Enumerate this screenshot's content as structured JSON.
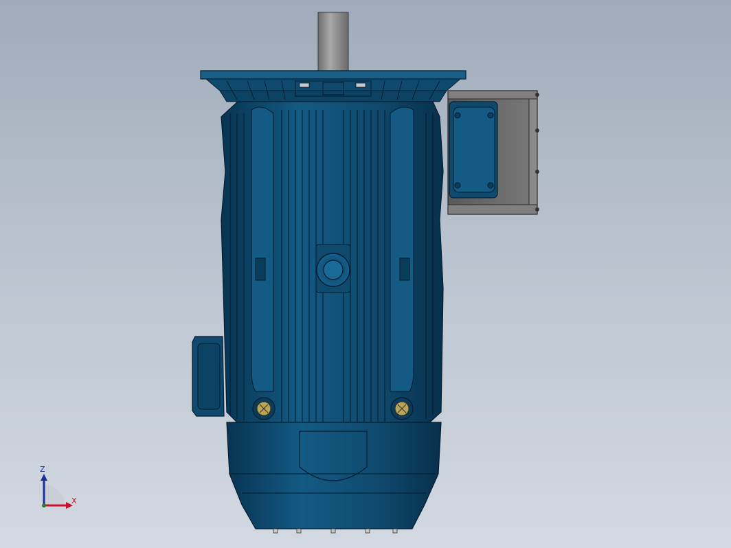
{
  "viewport": {
    "background_top": "#9fabba",
    "background_bottom": "#d3d9e1"
  },
  "model": {
    "body_color": "#0f4a6e",
    "body_shadow": "#083452",
    "edge_color": "#041c2e",
    "shaft_color": "#8c8c8c",
    "terminal_box_color": "#6b6b6b"
  },
  "triad": {
    "z_label": "Z",
    "x_label": "X",
    "z_color": "#1a2f9c",
    "x_color": "#c8102e"
  }
}
